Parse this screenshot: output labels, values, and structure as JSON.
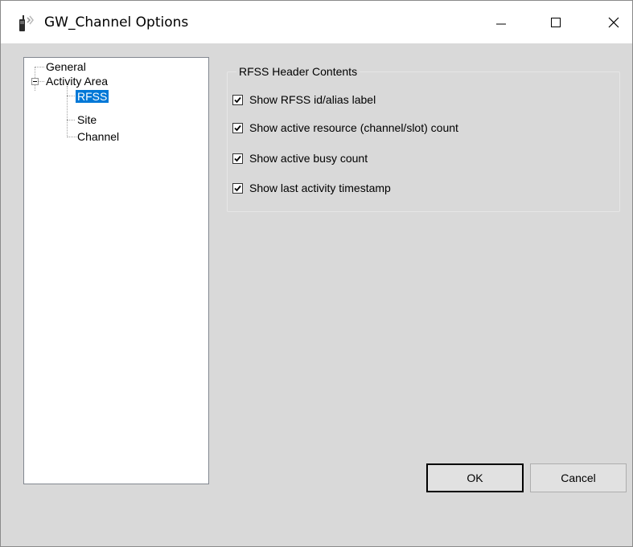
{
  "window": {
    "title": "GW_Channel Options",
    "icon": "radio-handset-icon"
  },
  "title_buttons": {
    "minimize_icon": "minimize-icon",
    "maximize_icon": "maximize-icon",
    "close_icon": "close-icon"
  },
  "tree": {
    "items": [
      {
        "label": "General",
        "level": 0
      },
      {
        "label": "Activity Area",
        "level": 0,
        "expanded": true
      },
      {
        "label": "RFSS",
        "level": 1,
        "selected": true
      },
      {
        "label": "Site",
        "level": 1
      },
      {
        "label": "Channel",
        "level": 1
      }
    ]
  },
  "group": {
    "title": "RFSS Header Contents",
    "options": [
      {
        "label": "Show RFSS id/alias label",
        "checked": true
      },
      {
        "label": "Show active resource (channel/slot) count",
        "checked": true
      },
      {
        "label": "Show active busy count",
        "checked": true
      },
      {
        "label": "Show last activity timestamp",
        "checked": true
      }
    ]
  },
  "buttons": {
    "ok": "OK",
    "cancel": "Cancel"
  },
  "colors": {
    "selection": "#0078d7",
    "dialog_bg": "#d9d9d9"
  }
}
